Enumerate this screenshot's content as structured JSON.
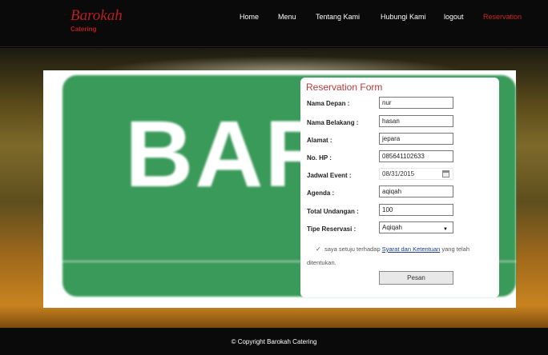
{
  "brand": {
    "name": "Barokah",
    "sub": "Catering"
  },
  "nav": {
    "home": "Home",
    "menu": "Menu",
    "about": "Tentang Kami",
    "contact": "Hubungi Kami",
    "logout": "logout",
    "reservation": "Reservation",
    "active_color": "#cc2626"
  },
  "banner": {
    "text": "BAR"
  },
  "form": {
    "title": "Reservation Form",
    "fields": {
      "nama_depan": {
        "label": "Nama Depan :",
        "value": "nur"
      },
      "nama_belakang": {
        "label": "Nama Belakang :",
        "value": "hasan"
      },
      "alamat": {
        "label": "Alamat :",
        "value": "jepara"
      },
      "no_hp": {
        "label": "No. HP :",
        "value": "085641102633"
      },
      "jadwal_event": {
        "label": "Jadwal Event :",
        "value": "08/31/2015"
      },
      "agenda": {
        "label": "Agenda :",
        "value": "aqiqah"
      },
      "total_undangan": {
        "label": "Total Undangan :",
        "value": "100"
      },
      "tipe_reservasi": {
        "label": "Tipe Reservasi :",
        "value": "Aqiqah"
      }
    },
    "agree_prefix": "saya setuju terhadap",
    "agree_link": "Syarat dan Ketentuan",
    "agree_suffix": "yang telah ditentukan.",
    "submit_label": "Pesan"
  },
  "footer": {
    "copyright": "© Copyright Barokah Catering"
  }
}
